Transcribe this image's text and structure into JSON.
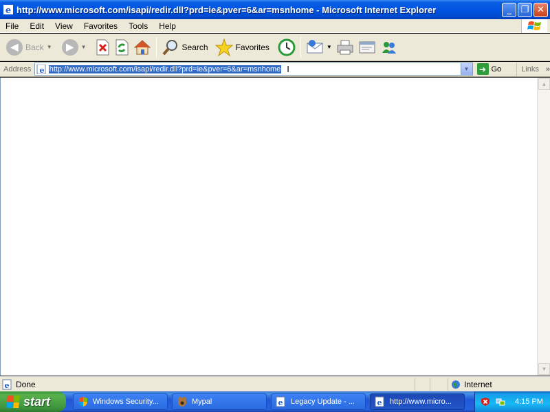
{
  "window": {
    "title": "http://www.microsoft.com/isapi/redir.dll?prd=ie&pver=6&ar=msnhome - Microsoft Internet Explorer",
    "minimize": "_",
    "maximize": "❐",
    "close": "✕"
  },
  "menu": [
    "File",
    "Edit",
    "View",
    "Favorites",
    "Tools",
    "Help"
  ],
  "toolbar": {
    "back_label": "Back",
    "search_label": "Search",
    "favorites_label": "Favorites"
  },
  "address": {
    "label": "Address",
    "url": "http://www.microsoft.com/isapi/redir.dll?prd=ie&pver=6&ar=msnhome",
    "go_label": "Go",
    "links_label": "Links",
    "chevron": "»"
  },
  "status": {
    "text": "Done",
    "zone": "Internet"
  },
  "taskbar": {
    "start_label": "start",
    "tasks": [
      {
        "label": "Windows Security...",
        "icon": "security-shield-icon",
        "active": false
      },
      {
        "label": "Mypal",
        "icon": "mypal-icon",
        "active": false
      },
      {
        "label": "Legacy Update - ...",
        "icon": "ie-page-icon",
        "active": false
      },
      {
        "label": "http://www.micro...",
        "icon": "ie-page-icon",
        "active": true
      }
    ],
    "clock": "4:15 PM"
  },
  "colors": {
    "titlebar": "#0054e3",
    "chrome": "#ece9d8",
    "selection": "#316ac5",
    "start_green": "#3d943d",
    "taskbar_blue": "#2157d7"
  }
}
